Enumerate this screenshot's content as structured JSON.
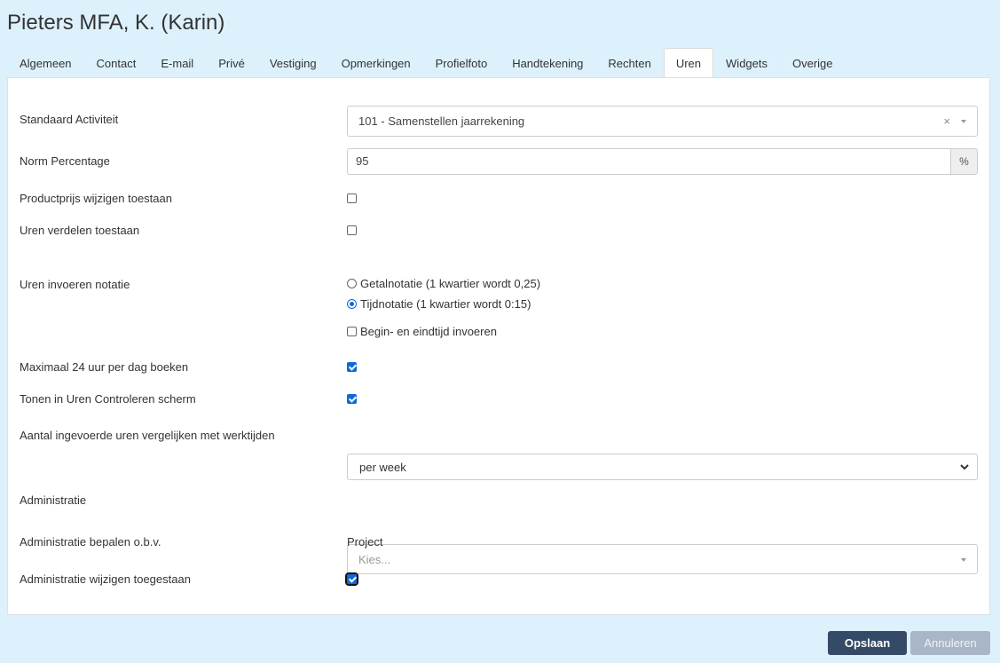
{
  "title": "Pieters MFA, K. (Karin)",
  "tabs": [
    {
      "label": "Algemeen"
    },
    {
      "label": "Contact"
    },
    {
      "label": "E-mail"
    },
    {
      "label": "Privé"
    },
    {
      "label": "Vestiging"
    },
    {
      "label": "Opmerkingen"
    },
    {
      "label": "Profielfoto"
    },
    {
      "label": "Handtekening"
    },
    {
      "label": "Rechten"
    },
    {
      "label": "Uren",
      "active": true
    },
    {
      "label": "Widgets"
    },
    {
      "label": "Overige"
    }
  ],
  "form": {
    "standaard_activiteit": {
      "label": "Standaard Activiteit",
      "value": "101 - Samenstellen jaarrekening",
      "clear": "×"
    },
    "norm_percentage": {
      "label": "Norm Percentage",
      "value": "95",
      "unit": "%"
    },
    "productprijs": {
      "label": "Productprijs wijzigen toestaan",
      "checked": false
    },
    "uren_verdelen": {
      "label": "Uren verdelen toestaan",
      "checked": false
    },
    "notatie": {
      "label": "Uren invoeren notatie",
      "options": [
        {
          "label": "Getalnotatie (1 kwartier wordt 0,25)",
          "selected": false
        },
        {
          "label": "Tijdnotatie (1 kwartier wordt 0:15)",
          "selected": true
        }
      ],
      "begin_eind": {
        "label": "Begin- en eindtijd invoeren",
        "checked": false
      }
    },
    "max24": {
      "label": "Maximaal 24 uur per dag boeken",
      "checked": true
    },
    "tonen": {
      "label": "Tonen in Uren Controleren scherm",
      "checked": true
    },
    "vergelijken": {
      "label": "Aantal ingevoerde uren vergelijken met werktijden",
      "value": "per week"
    },
    "administratie": {
      "label": "Administratie",
      "placeholder": "Kies..."
    },
    "administratie_bepalen": {
      "label": "Administratie bepalen o.b.v.",
      "value": "Project"
    },
    "administratie_wijzigen": {
      "label": "Administratie wijzigen toegestaan",
      "checked": true
    }
  },
  "buttons": {
    "save": "Opslaan",
    "cancel": "Annuleren"
  },
  "colors": {
    "background": "#ddf1fc",
    "primary": "#354a66",
    "accent": "#0b6ad8"
  }
}
